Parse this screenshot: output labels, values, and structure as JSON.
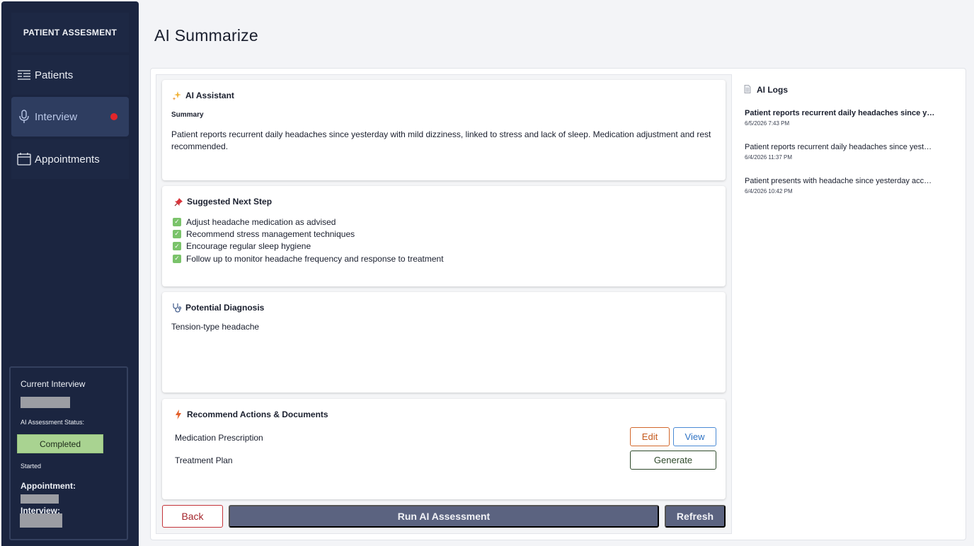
{
  "sidebar": {
    "brand": "PATIENT ASSESMENT",
    "items": [
      {
        "label": "Patients",
        "icon": "list-icon"
      },
      {
        "label": "Interview",
        "icon": "microphone-icon",
        "active": true,
        "indicator": "#e3262b"
      },
      {
        "label": "Appointments",
        "icon": "calendar-icon"
      }
    ],
    "current": {
      "title": "Current Interview",
      "status_label": "AI Assessment Status:",
      "status_value": "Completed",
      "started": "Started",
      "appointment_label": "Appointment:",
      "interview_label": "Interview:"
    }
  },
  "page": {
    "title": "AI Summarize"
  },
  "assistant": {
    "title": "AI Assistant",
    "icon": "sparkles-icon",
    "summary_label": "Summary",
    "summary_text": "Patient reports recurrent daily headaches since yesterday with mild dizziness, linked to stress and lack of sleep. Medication adjustment and rest recommended."
  },
  "next_step": {
    "title": "Suggested Next Step",
    "icon": "pushpin-icon",
    "items": [
      "Adjust headache medication as advised",
      "Recommend stress management techniques",
      "Encourage regular sleep hygiene",
      "Follow up to monitor headache frequency and response to treatment"
    ]
  },
  "diagnosis": {
    "title": "Potential Diagnosis",
    "icon": "stethoscope-icon",
    "text": "Tension-type headache"
  },
  "actions": {
    "title": "Recommend Actions & Documents",
    "icon": "lightning-icon",
    "rows": [
      {
        "label": "Medication Prescription",
        "edit": "Edit",
        "view": "View"
      },
      {
        "label": "Treatment Plan",
        "generate": "Generate"
      }
    ]
  },
  "footer": {
    "back": "Back",
    "run": "Run AI Assessment",
    "refresh": "Refresh"
  },
  "logs": {
    "title": "AI Logs",
    "icon": "document-icon",
    "items": [
      {
        "text": "Patient reports recurrent daily headaches since yesterday with mild dizziness",
        "time": "6/5/2026 7:43 PM"
      },
      {
        "text": "Patient reports recurrent daily headaches since yesterday with mild dizziness",
        "time": "6/4/2026 11:37 PM"
      },
      {
        "text": "Patient presents with headache since yesterday accompanied by dizziness",
        "time": "6/4/2026 10:42 PM"
      }
    ]
  },
  "colors": {
    "sidebar": "#1b2540",
    "active_nav": "#2e3d60",
    "status_completed": "#a9d391",
    "primary_button": "#5b6380",
    "edit": "#d2672b",
    "view": "#4a8ad4"
  }
}
